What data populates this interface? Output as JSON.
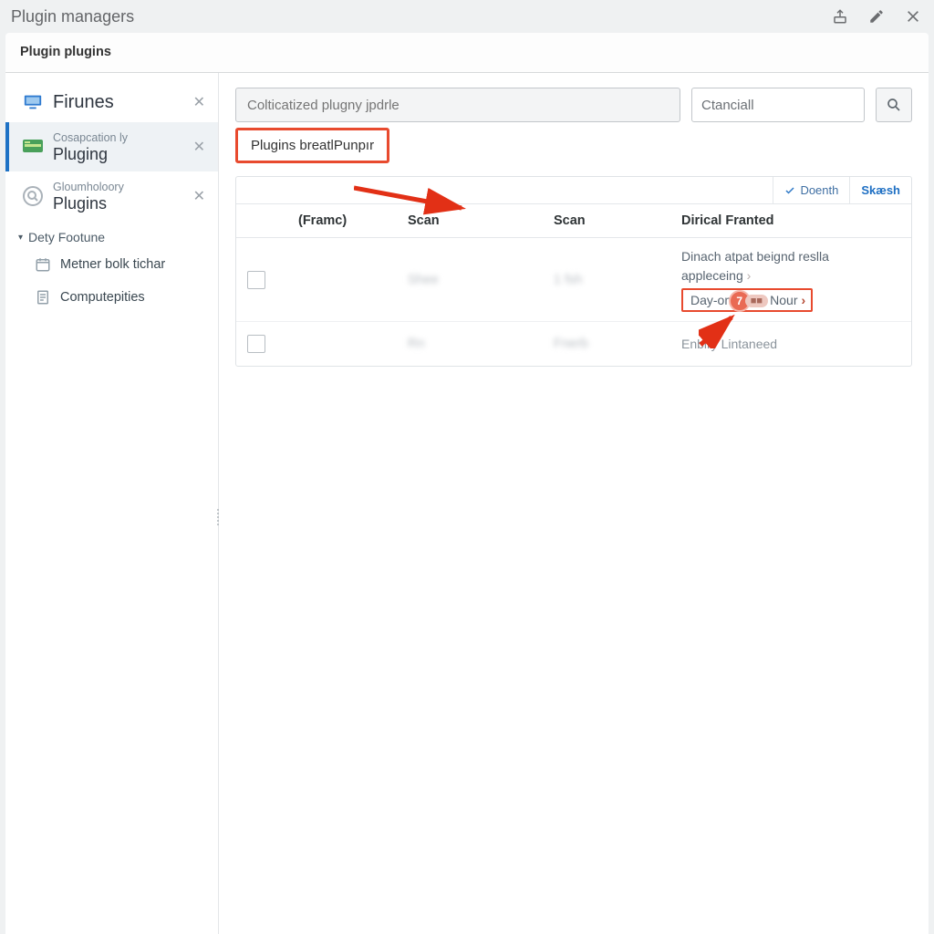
{
  "title": "Plugin managers",
  "tab_label": "Plugin plugins",
  "sidebar": {
    "items": [
      {
        "sup": "",
        "main": "Firunes"
      },
      {
        "sup": "Cosapcation ly",
        "main": "Pluging"
      },
      {
        "sup": "Gloumholoory",
        "main": "Plugins"
      }
    ],
    "tree_header": "Dety Footune",
    "tree_items": [
      "Metner bolk tichar",
      "Computepities"
    ]
  },
  "search": {
    "main_placeholder": "Colticatized plugny jpdrle",
    "small_value": "Ctanciall"
  },
  "callout": "Plugins breatlPunpır",
  "toolbar": {
    "check_label": "Doenth",
    "search_label": "Skæsh"
  },
  "columns": [
    "(Framc)",
    "Scan",
    "Scan",
    "Dirical Franted"
  ],
  "rows": [
    {
      "a": "Shee",
      "b": "1 fsh",
      "info1": "Dinach atpat beignd reslla",
      "info1b": "appleceing",
      "hot": "Day-omied at Nour"
    },
    {
      "a": "Rn",
      "b": "Fnerb",
      "info2": "Enbiry Lintaneed"
    }
  ],
  "badge_digit": "7"
}
